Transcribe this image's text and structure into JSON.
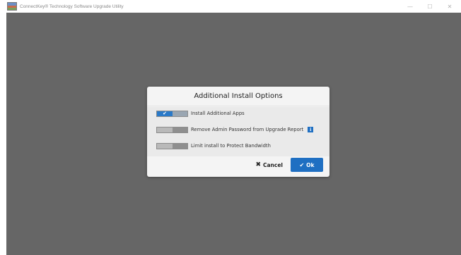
{
  "window": {
    "title": "ConnectKey® Technology Software Upgrade Utility",
    "controls": {
      "minimize": "—",
      "maximize": "☐",
      "close": "✕"
    }
  },
  "dialog": {
    "title": "Additional Install Options",
    "options": [
      {
        "label": "Install Additional Apps",
        "enabled": true,
        "toggle_icon": "✔"
      },
      {
        "label": "Remove Admin Password from Upgrade Report",
        "enabled": false,
        "info_icon": "i"
      },
      {
        "label": "Limit install to Protect Bandwidth",
        "enabled": false
      }
    ],
    "buttons": {
      "cancel_icon": "✖",
      "cancel_label": "Cancel",
      "ok_icon": "✔",
      "ok_label": "Ok"
    }
  },
  "colors": {
    "accent": "#1f6fc2",
    "backdrop": "#666666",
    "dialog_bg": "#f4f4f4"
  }
}
